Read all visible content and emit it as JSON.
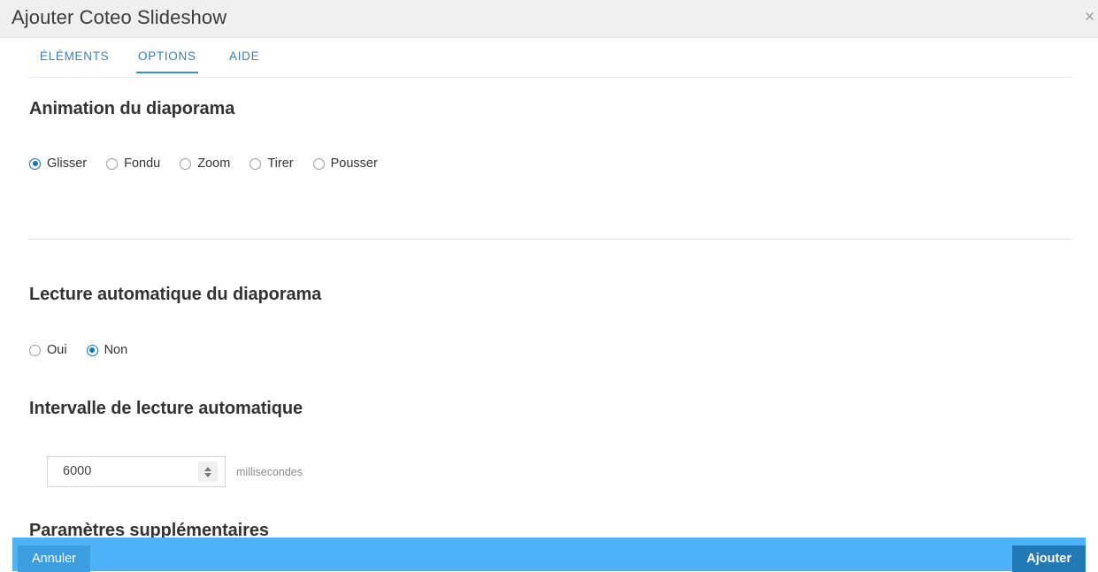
{
  "header": {
    "title": "Ajouter Coteo Slideshow",
    "close_icon": "close-icon",
    "close_glyph": "×"
  },
  "tabs": [
    {
      "label": "ÉLÉMENTS",
      "active": false
    },
    {
      "label": "OPTIONS",
      "active": true
    },
    {
      "label": "AIDE",
      "active": false
    }
  ],
  "sections": {
    "animation": {
      "heading": "Animation du diaporama",
      "options": [
        {
          "label": "Glisser",
          "checked": true
        },
        {
          "label": "Fondu",
          "checked": false
        },
        {
          "label": "Zoom",
          "checked": false
        },
        {
          "label": "Tirer",
          "checked": false
        },
        {
          "label": "Pousser",
          "checked": false
        }
      ]
    },
    "autoplay": {
      "heading": "Lecture automatique du diaporama",
      "options": [
        {
          "label": "Oui",
          "checked": false
        },
        {
          "label": "Non",
          "checked": true
        }
      ]
    },
    "interval": {
      "heading": "Intervalle de lecture automatique",
      "value": "6000",
      "placeholder": "6000",
      "unit": "millisecondes",
      "spinner_icon": "spinner-updown-icon"
    },
    "clipped": {
      "heading": "Paramètres supplémentaires"
    }
  },
  "footer": {
    "cancel_label": "Annuler",
    "submit_label": "Ajouter"
  },
  "colors": {
    "header_bg": "#efefef",
    "accent_blue": "#3c8dce",
    "footer_bg": "#4db2f7",
    "cancel_bg": "#3c9ede",
    "submit_bg": "#2279b5",
    "radio_checked": "#1270d1",
    "heading_text": "#333333"
  }
}
